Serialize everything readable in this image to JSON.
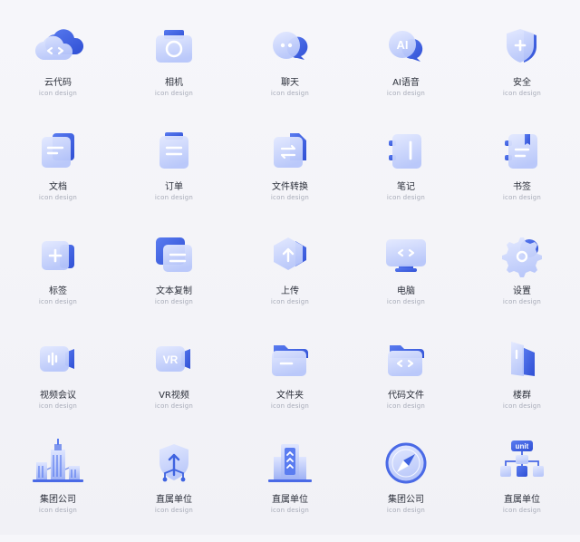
{
  "sheet": {
    "sub_label": "icon design",
    "colors": {
      "accent": "#3f63e0",
      "glass": "#c9d4fb",
      "background": "#f4f4f8",
      "label": "#2b2f3a",
      "sub_label": "#a7abb8"
    }
  },
  "icons": [
    {
      "label": "云代码",
      "icon": "cloud-code-icon"
    },
    {
      "label": "相机",
      "icon": "camera-icon"
    },
    {
      "label": "聊天",
      "icon": "chat-icon"
    },
    {
      "label": "AI语音",
      "icon": "ai-voice-icon",
      "glyph": "AI"
    },
    {
      "label": "安全",
      "icon": "shield-icon"
    },
    {
      "label": "文档",
      "icon": "document-icon"
    },
    {
      "label": "订单",
      "icon": "order-icon"
    },
    {
      "label": "文件转换",
      "icon": "file-convert-icon"
    },
    {
      "label": "笔记",
      "icon": "notebook-icon"
    },
    {
      "label": "书签",
      "icon": "bookmark-icon"
    },
    {
      "label": "标签",
      "icon": "tag-icon"
    },
    {
      "label": "文本复制",
      "icon": "copy-text-icon"
    },
    {
      "label": "上传",
      "icon": "upload-icon"
    },
    {
      "label": "电脑",
      "icon": "computer-icon"
    },
    {
      "label": "设置",
      "icon": "gear-icon"
    },
    {
      "label": "视频会议",
      "icon": "video-meeting-icon"
    },
    {
      "label": "VR视频",
      "icon": "vr-video-icon",
      "glyph": "VR"
    },
    {
      "label": "文件夹",
      "icon": "folder-icon"
    },
    {
      "label": "代码文件",
      "icon": "code-folder-icon"
    },
    {
      "label": "楼群",
      "icon": "building-group-icon"
    },
    {
      "label": "集团公司",
      "icon": "skyscraper-icon"
    },
    {
      "label": "直属单位",
      "icon": "shield-network-icon"
    },
    {
      "label": "直属单位",
      "icon": "tower-icon"
    },
    {
      "label": "集团公司",
      "icon": "compass-icon"
    },
    {
      "label": "直属单位",
      "icon": "org-chart-icon",
      "glyph": "unit"
    }
  ]
}
